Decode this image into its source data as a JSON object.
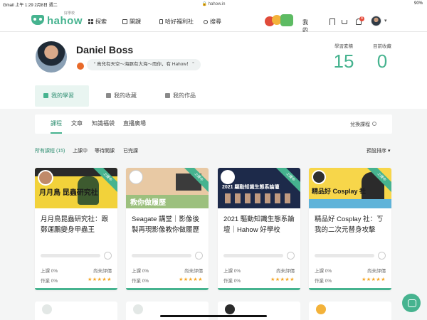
{
  "status_bar": {
    "left": "Gmail  上午 1:29  2月8日 週二",
    "url": "🔒 hahow.in",
    "right": "90%"
  },
  "brand": {
    "name": "hahow",
    "tagline": "好學校"
  },
  "nav": {
    "links": [
      {
        "label": "探索",
        "icon": "grid-icon"
      },
      {
        "label": "開課",
        "icon": "book-icon"
      },
      {
        "label": "哈好福利社",
        "icon": "phone-icon"
      },
      {
        "label": "搜尋",
        "icon": "search-icon"
      }
    ],
    "my_learning": "我的學習",
    "notification_count": "8"
  },
  "profile": {
    "name": "Daniel Boss",
    "bio": "“ 鳥兒有天空～海豚有大海～而你，有 Hahow！ ”",
    "stats": [
      {
        "label": "學習素積",
        "value": "15"
      },
      {
        "label": "目前收藏",
        "value": "0"
      }
    ],
    "tabs": [
      {
        "label": "我的學習",
        "active": true
      },
      {
        "label": "我的收藏",
        "active": false
      },
      {
        "label": "我的作品",
        "active": false
      }
    ]
  },
  "content_tabs": {
    "tabs": [
      {
        "label": "課程",
        "active": true
      },
      {
        "label": "文章",
        "active": false
      },
      {
        "label": "知識福袋",
        "active": false
      },
      {
        "label": "直播廣場",
        "active": false
      }
    ],
    "switch_label": "兌換課程"
  },
  "filters": {
    "items": [
      {
        "label": "所有課程 (15)",
        "active": true
      },
      {
        "label": "上課中",
        "active": false
      },
      {
        "label": "等待開課",
        "active": false
      },
      {
        "label": "已完課",
        "active": false
      }
    ],
    "sort_label": "預設排序 ▾"
  },
  "courses": [
    {
      "title": "月月鳥昆蟲研究社：跟鄭運鵬變身甲蟲王",
      "thumb_text": "月月鳥 昆蟲研究社",
      "ribbon": "上課中",
      "lesson_progress": "上課 0%",
      "homework_progress": "作業 0%",
      "rating_status": "尚未評價",
      "stars": "★★★★★",
      "progress": 0
    },
    {
      "title": "Seagate 講堂｜影像後製再現影像教你做履歷",
      "thumb_text": "教你做履歷",
      "ribbon": "上課中",
      "lesson_progress": "上課 0%",
      "homework_progress": "作業 0%",
      "rating_status": "尚未評價",
      "stars": "★★★★★",
      "progress": 0
    },
    {
      "title": "2021 驅動知識生態系論壇｜Hahow 好學校",
      "thumb_text": "2021 驅動知識生態系論壇",
      "ribbon": "上課中",
      "lesson_progress": "上課 0%",
      "homework_progress": "作業 0%",
      "rating_status": "尚未評價",
      "stars": "★★★★★",
      "progress": 0
    },
    {
      "title": "精品好 Cosplay 社：ㄎ我的二次元替身攻擊",
      "thumb_text": "精品好 Cosplay 社",
      "ribbon": "上課中",
      "lesson_progress": "上課 0%",
      "homework_progress": "作業 0%",
      "rating_status": "尚未評價",
      "stars": "★★★★★",
      "progress": 0
    }
  ],
  "colors": {
    "brand": "#46b38f",
    "accent_text": "#2f8f72",
    "badge": "#e64c3c"
  }
}
